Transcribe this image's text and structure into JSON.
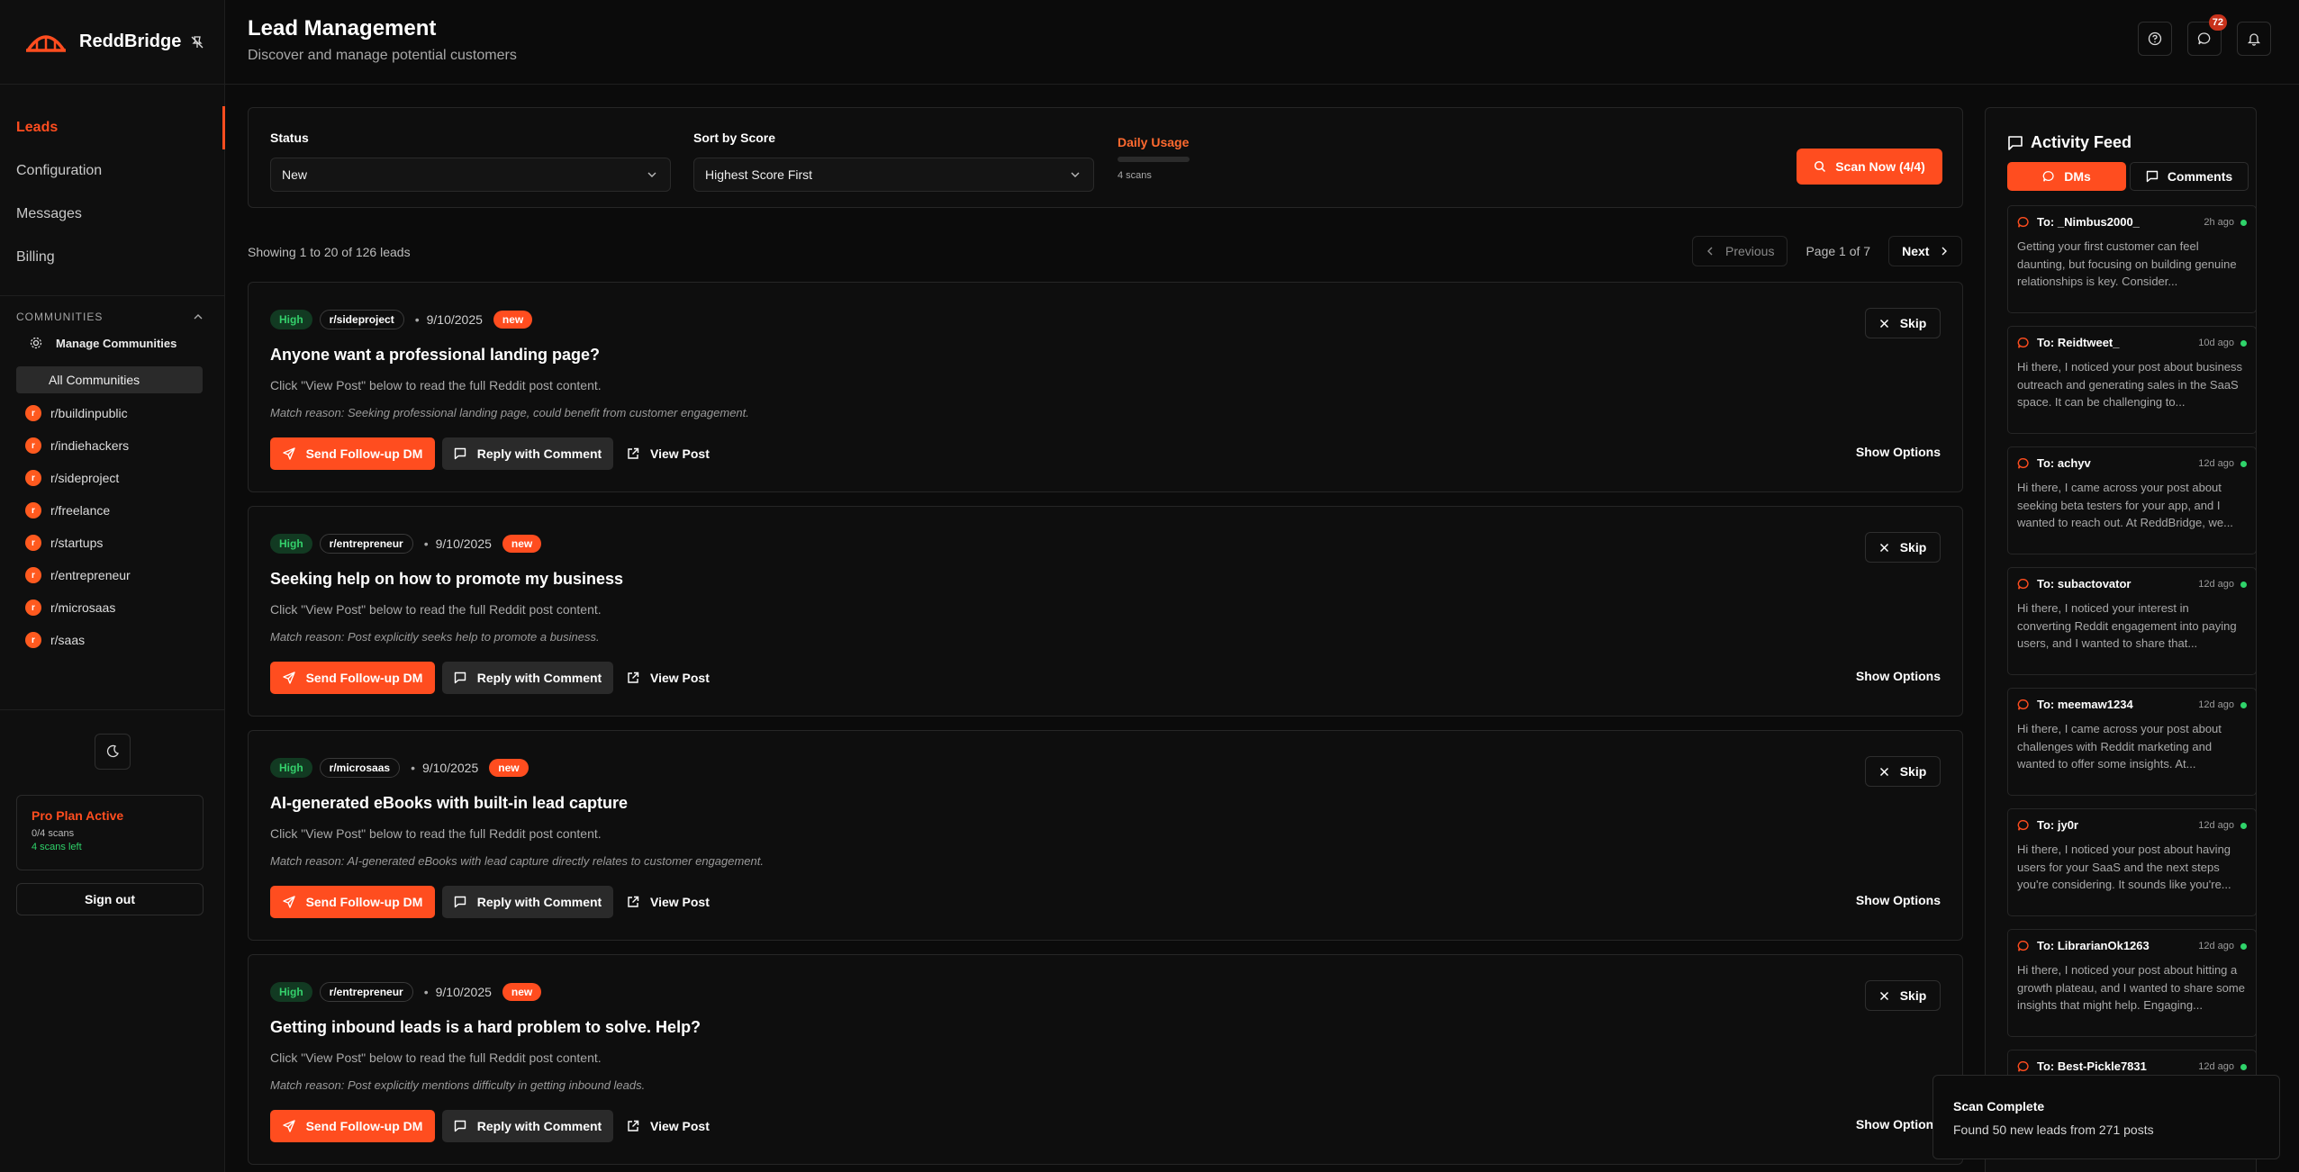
{
  "brand": {
    "name": "ReddBridge"
  },
  "nav": [
    {
      "label": "Leads",
      "active": true
    },
    {
      "label": "Configuration",
      "active": false
    },
    {
      "label": "Messages",
      "active": false
    },
    {
      "label": "Billing",
      "active": false
    }
  ],
  "communities": {
    "heading": "COMMUNITIES",
    "manage_label": "Manage Communities",
    "all_label": "All Communities",
    "avatar_letter": "r",
    "items": [
      "r/buildinpublic",
      "r/indiehackers",
      "r/sideproject",
      "r/freelance",
      "r/startups",
      "r/entrepreneur",
      "r/microsaas",
      "r/saas"
    ]
  },
  "plan": {
    "title": "Pro Plan Active",
    "scans": "0/4 scans",
    "left": "4 scans left",
    "signout": "Sign out"
  },
  "header": {
    "title": "Lead Management",
    "subtitle": "Discover and manage potential customers",
    "messages_badge": "72"
  },
  "filters": {
    "status_label": "Status",
    "status_value": "New",
    "sort_label": "Sort by Score",
    "sort_value": "Highest Score First",
    "usage_label": "Daily Usage",
    "usage_sub": "4 scans",
    "usage_fraction": 0,
    "scan_button": "Scan Now (4/4)"
  },
  "pagination": {
    "showing": "Showing 1 to 20 of 126 leads",
    "previous": "Previous",
    "page_text": "Page 1 of 7",
    "next": "Next"
  },
  "lead_labels": {
    "dm": "Send Follow-up DM",
    "reply": "Reply with Comment",
    "view": "View Post",
    "skip": "Skip",
    "options": "Show Options",
    "dot": "•"
  },
  "leads": [
    {
      "score": "High",
      "subreddit": "r/sideproject",
      "date": "9/10/2025",
      "status": "new",
      "title": "Anyone want a professional landing page?",
      "description": "Click \"View Post\" below to read the full Reddit post content.",
      "reason": "Match reason: Seeking professional landing page, could benefit from customer engagement."
    },
    {
      "score": "High",
      "subreddit": "r/entrepreneur",
      "date": "9/10/2025",
      "status": "new",
      "title": "Seeking help on how to promote my business",
      "description": "Click \"View Post\" below to read the full Reddit post content.",
      "reason": "Match reason: Post explicitly seeks help to promote a business."
    },
    {
      "score": "High",
      "subreddit": "r/microsaas",
      "date": "9/10/2025",
      "status": "new",
      "title": "AI-generated eBooks with built-in lead capture",
      "description": "Click \"View Post\" below to read the full Reddit post content.",
      "reason": "Match reason: AI-generated eBooks with lead capture directly relates to customer engagement."
    },
    {
      "score": "High",
      "subreddit": "r/entrepreneur",
      "date": "9/10/2025",
      "status": "new",
      "title": "Getting inbound leads is a hard problem to solve. Help?",
      "description": "Click \"View Post\" below to read the full Reddit post content.",
      "reason": "Match reason: Post explicitly mentions difficulty in getting inbound leads."
    }
  ],
  "feed": {
    "title": "Activity Feed",
    "tab_dms": "DMs",
    "tab_comments": "Comments",
    "items": [
      {
        "to": "To: _Nimbus2000_",
        "time": "2h ago",
        "body": "Getting your first customer can feel daunting, but focusing on building genuine relationships is key. Consider..."
      },
      {
        "to": "To: Reidtweet_",
        "time": "10d ago",
        "body": "Hi there, I noticed your post about business outreach and generating sales in the SaaS space. It can be challenging to..."
      },
      {
        "to": "To: achyv",
        "time": "12d ago",
        "body": "Hi there, I came across your post about seeking beta testers for your app, and I wanted to reach out. At ReddBridge, we..."
      },
      {
        "to": "To: subactovator",
        "time": "12d ago",
        "body": "Hi there, I noticed your interest in converting Reddit engagement into paying users, and I wanted to share that..."
      },
      {
        "to": "To: meemaw1234",
        "time": "12d ago",
        "body": "Hi there, I came across your post about challenges with Reddit marketing and wanted to offer some insights. At..."
      },
      {
        "to": "To: jy0r",
        "time": "12d ago",
        "body": "Hi there, I noticed your post about having users for your SaaS and the next steps you're considering. It sounds like you're..."
      },
      {
        "to": "To: LibrarianOk1263",
        "time": "12d ago",
        "body": "Hi there, I noticed your post about hitting a growth plateau, and I wanted to share some insights that might help. Engaging..."
      },
      {
        "to": "To: Best-Pickle7831",
        "time": "12d ago",
        "body": ""
      }
    ]
  },
  "toast": {
    "title": "Scan Complete",
    "body": "Found 50 new leads from 271 posts"
  },
  "colors": {
    "accent": "#ff4d1f",
    "high_badge": "#34d06b",
    "online_dot": "#2fd36a",
    "badge": "#c8321b"
  },
  "icons": [
    "bridge-logo-icon",
    "unpin-icon",
    "help-icon",
    "message-icon",
    "bell-icon",
    "gear-icon",
    "moon-icon",
    "chevron-down-icon",
    "search-icon",
    "send-icon",
    "comment-icon",
    "external-link-icon",
    "close-icon",
    "chevron-left-icon",
    "chevron-right-icon"
  ]
}
